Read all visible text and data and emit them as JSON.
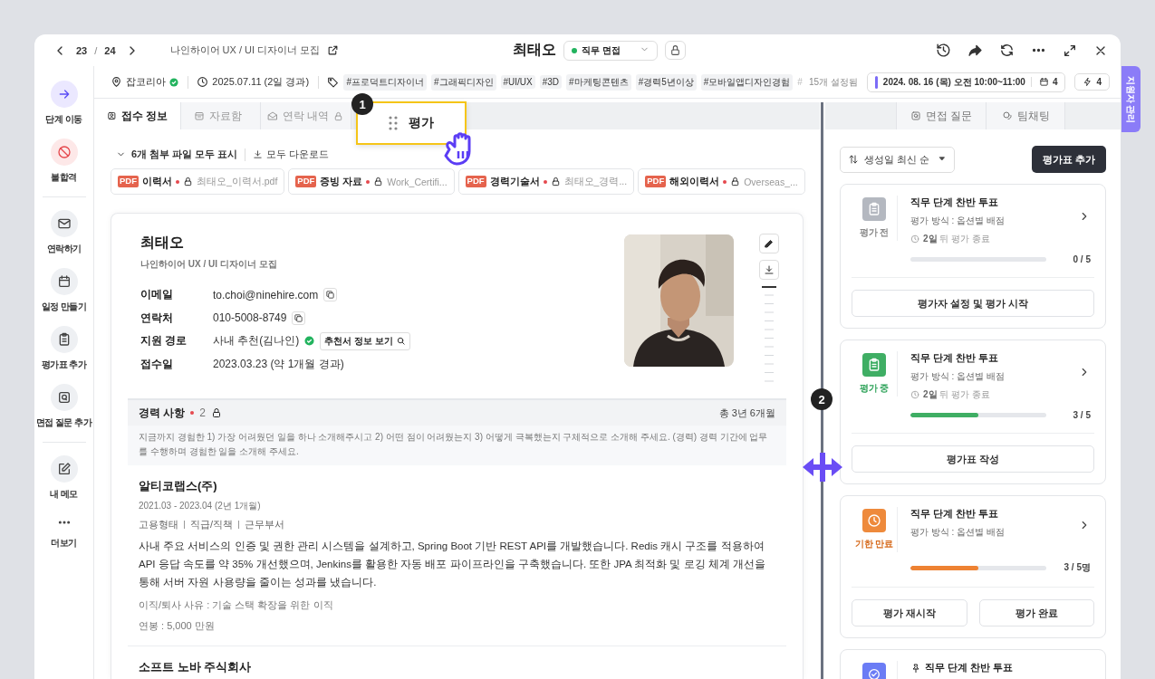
{
  "header": {
    "current": "23",
    "separator": "/",
    "total": "24",
    "job_link": "나인하이어 UX / UI 디자이너 모집",
    "title": "최태오",
    "stage": "직무 면접"
  },
  "info_bar": {
    "source": "잡코리아",
    "source_verified": true,
    "date": "2025.07.11 (2일 경과)",
    "tags": [
      "#프로덕트디자이너",
      "#그래픽디자인",
      "#UI/UX",
      "#3D",
      "#마케팅콘텐츠",
      "#경력5년이상",
      "#모바일앱디자인경험"
    ],
    "tag_overflow": "#",
    "tag_count": "15개 설정됨",
    "schedule": "2024. 08. 16 (목) 오전 10:00~11:00",
    "calendar_count": "4",
    "flash_count": "4"
  },
  "sidebar": {
    "groups": [
      {
        "items": [
          {
            "label": "단계 이동",
            "kind": "primary"
          },
          {
            "label": "불합격",
            "kind": "danger"
          }
        ]
      },
      {
        "items": [
          {
            "label": "연락하기",
            "kind": "default"
          },
          {
            "label": "일정 만들기",
            "kind": "default"
          },
          {
            "label": "평가표 추가",
            "kind": "default"
          },
          {
            "label": "면접 질문 추가",
            "kind": "default"
          }
        ]
      },
      {
        "items": [
          {
            "label": "내 메모",
            "kind": "default"
          },
          {
            "label": "더보기",
            "kind": "plain"
          }
        ]
      }
    ]
  },
  "tabs": [
    {
      "label": "접수 정보",
      "selected": true,
      "locked": false
    },
    {
      "label": "자료함",
      "selected": false,
      "locked": false
    },
    {
      "label": "연락 내역",
      "selected": false,
      "locked": true
    }
  ],
  "dragged_tab": {
    "label": "평가",
    "badge": "1"
  },
  "attachments": {
    "toggle": "6개 첨부 파일 모두 표시",
    "download_all": "모두 다운로드",
    "files": [
      {
        "type": "PDF",
        "name": "이력서",
        "required": true,
        "locked": true,
        "file": "최태오_이력서.pdf"
      },
      {
        "type": "PDF",
        "name": "증빙 자료",
        "required": true,
        "locked": true,
        "file": "Work_Certifi..."
      },
      {
        "type": "PDF",
        "name": "경력기술서",
        "required": true,
        "locked": true,
        "file": "최태오_경력..."
      },
      {
        "type": "PDF",
        "name": "해외이력서",
        "required": true,
        "locked": true,
        "file": "Overseas_..."
      }
    ]
  },
  "profile": {
    "name": "최태오",
    "job": "나인하이어 UX / UI 디자이너 모집",
    "fields": [
      {
        "label": "이메일",
        "value": "to.choi@ninehire.com",
        "kind": "copy"
      },
      {
        "label": "연락처",
        "value": "010-5008-8749",
        "kind": "copy"
      },
      {
        "label": "지원 경로",
        "value": "사내 추천(김나인)",
        "kind": "referral",
        "verified": true,
        "button": "추천서 정보 보기"
      },
      {
        "label": "접수일",
        "value": "2023.03.23 (약 1개월 경과)",
        "kind": "plain"
      }
    ]
  },
  "experience": {
    "title": "경력 사항",
    "required": true,
    "count": "2",
    "locked": true,
    "total": "총 3년 6개월",
    "prompt": "지금까지 경험한 1) 가장 어려웠던 일을 하나 소개해주시고 2) 어떤 점이 어려웠는지 3) 어떻게 극복했는지 구체적으로 소개해 주세요. (경력) 경력 기간에 업무를 수행하며 경험한 일을 소개해 주세요.",
    "entries": [
      {
        "company": "알티코랩스(주)",
        "period": "2021.03 - 2023.04 (2년 1개월)",
        "meta": [
          "고용형태",
          "직급/직책",
          "근무부서"
        ],
        "description": "사내 주요 서비스의 인증 및 권한 관리 시스템을 설계하고, Spring Boot 기반 REST API를 개발했습니다. Redis 캐시 구조를 적용하여 API 응답 속도를 약 35% 개선했으며, Jenkins를 활용한 자동 배포 파이프라인을 구축했습니다. 또한 JPA 최적화 및 로깅 체계 개선을 통해 서버 자원 사용량을 줄이는 성과를 냈습니다.",
        "reason": "이직/퇴사 사유 : 기술 스택 확장을 위한 이직",
        "salary": "연봉 : 5,000 만원"
      },
      {
        "company": "소프트 노바 주식회사"
      }
    ]
  },
  "resize_badge": "2",
  "right_tabs": [
    {
      "label": "면접 질문",
      "selected": false
    },
    {
      "label": "팀채팅",
      "selected": false
    }
  ],
  "evaluation": {
    "sort": "생성일 최신 순",
    "add_button": "평가표 추가",
    "cards": [
      {
        "kind": "before",
        "status_label": "평가 전",
        "title": "직무 단계 찬반 투표",
        "method": "평가 방식 : 옵션별 배점",
        "deadline_bold": "2일",
        "deadline": "뒤 평가 종료",
        "level": 0,
        "count": "0 / 5",
        "actions": [
          "평가자 설정 및 평가 시작"
        ]
      },
      {
        "kind": "progress",
        "status_label": "평가 중",
        "title": "직무 단계 찬반 투표",
        "method": "평가 방식 : 옵션별 배점",
        "deadline_bold": "2일",
        "deadline": "뒤 평가 종료",
        "level": 0.5,
        "count": "3 / 5",
        "actions": [
          "평가표 작성"
        ]
      },
      {
        "kind": "expired",
        "status_label": "기한 만료",
        "title": "직무 단계 찬반 투표",
        "method": "평가 방식 : 옵션별 배점",
        "level": 0.5,
        "count": "3 / 5명",
        "actions": [
          "평가 재시작",
          "평가 완료"
        ]
      },
      {
        "kind": "done",
        "pinned": true,
        "title": "직무 단계 찬반 투표"
      }
    ]
  },
  "side_tab": "지원자 관리"
}
